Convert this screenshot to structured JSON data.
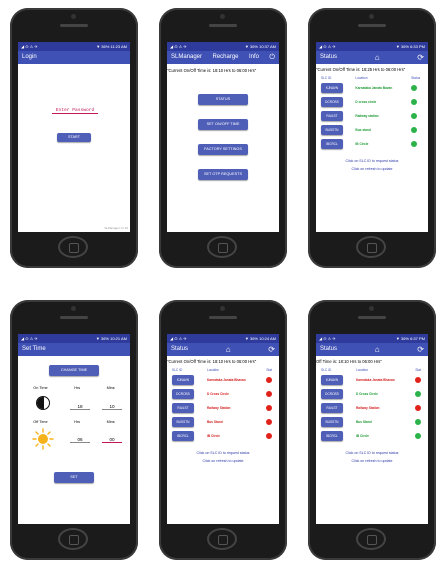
{
  "status_bar": {
    "p1_left": "◢ ⊙ ⚠ ✈",
    "p1_right": "▼ 36% 11:23 AM",
    "p2_right": "▼ 36% 10:37 AM",
    "p3_right": "▼ 36% 6:33 PM",
    "p4_right": "▼ 36% 10:21 AM",
    "p5_right": "▼ 36% 10:24 AM",
    "p6_right": "▼ 36% 6:37 PM"
  },
  "login": {
    "title": "Login",
    "password_placeholder": "Enter Password",
    "start_label": "START",
    "version": "SLManager v1.19"
  },
  "menu": {
    "tab1": "SLManager",
    "tab2": "Recharge",
    "tab3": "Info",
    "info": "\"Current On/Off Time is: 18:10 Hrs to 06:00 Hrs\"",
    "buttons": [
      "STATUS",
      "SET ON/OFF TIME",
      "FACTORY SETTINGS",
      "SET OTP REQUESTS"
    ]
  },
  "status_title": "Status",
  "status_green": {
    "info": "\"Current On/Off Time is: 18:25 Hrs to 06:00 Hrs\"",
    "col_id": "SLC ID",
    "col_loc": "Location",
    "col_stat": "Status",
    "rows": [
      {
        "id": "KJNAVN",
        "loc": "Karnataka Janata Bavan",
        "c": "green"
      },
      {
        "id": "DCROSS",
        "loc": "D cross circle",
        "c": "green"
      },
      {
        "id": "RAILST",
        "loc": "Railway station",
        "c": "green"
      },
      {
        "id": "BUSSTN",
        "loc": "Bus stand",
        "c": "green"
      },
      {
        "id": "IBCRCL",
        "loc": "IB Circle",
        "c": "green"
      }
    ]
  },
  "settime": {
    "title": "Set Time",
    "change_label": "CHANGE TIME",
    "on_time": "On Time",
    "off_time": "Off Time",
    "hrs": "Hrs",
    "mins": "Mins",
    "on_hrs": "18",
    "on_mins": "10",
    "off_hrs": "06",
    "off_mins": "00",
    "set_label": "SET"
  },
  "status_red": {
    "info": "\"Current On/Off Time is: 18:10 Hrs to 06:00 Hrs\"",
    "col_id": "SLC ID",
    "col_loc": "Location",
    "col_stat": "Stat",
    "rows": [
      {
        "id": "KJNAVN",
        "loc": "Karnataka Janata Bhavan",
        "c": "red"
      },
      {
        "id": "DCROSS",
        "loc": "D Cross Circle",
        "c": "red"
      },
      {
        "id": "RAILST",
        "loc": "Railway Station",
        "c": "red"
      },
      {
        "id": "BUSSTN",
        "loc": "Bus Stand",
        "c": "red"
      },
      {
        "id": "IBCRCL",
        "loc": "IB Circle",
        "c": "red"
      }
    ]
  },
  "status_mixed": {
    "info": "Off Time is: 18:10 Hrs to 06:00 Hrs\"",
    "col_id": "SLC ID",
    "col_loc": "Location",
    "col_stat": "Stat",
    "rows": [
      {
        "id": "KJNAVN",
        "loc": "Karnataka Janata Bhavan",
        "c": "red"
      },
      {
        "id": "DCROSS",
        "loc": "D Cross Circle",
        "c": "green"
      },
      {
        "id": "RAILST",
        "loc": "Railway Station",
        "c": "red"
      },
      {
        "id": "BUSSTN",
        "loc": "Bus Stand",
        "c": "green"
      },
      {
        "id": "IBCRCL",
        "loc": "IB Circle",
        "c": "green"
      }
    ]
  },
  "hints": {
    "request": "Click on SLC ID to request status",
    "refresh": "Click on refresh to update"
  },
  "icons": {
    "home": "home-icon",
    "refresh": "refresh-icon",
    "power": "power-icon",
    "moon": "moon-icon",
    "sun": "sun-icon"
  }
}
